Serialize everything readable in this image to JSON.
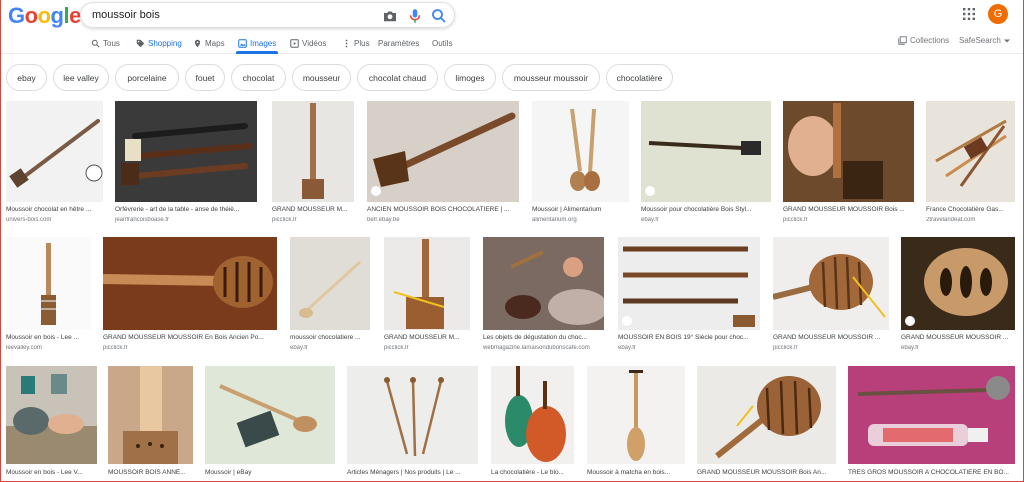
{
  "header": {
    "query": "moussoir bois",
    "avatar_letter": "G"
  },
  "tabs": [
    {
      "label": "Tous",
      "icon": "search-icon"
    },
    {
      "label": "Shopping",
      "icon": "tag-icon"
    },
    {
      "label": "Maps",
      "icon": "pin-icon"
    },
    {
      "label": "Images",
      "icon": "image-icon"
    },
    {
      "label": "Vidéos",
      "icon": "video-icon"
    },
    {
      "label": "Plus",
      "icon": "more-vert-icon"
    },
    {
      "label": "Paramètres",
      "icon": ""
    },
    {
      "label": "Outils",
      "icon": ""
    }
  ],
  "tools": {
    "collections": "Collections",
    "safesearch": "SafeSearch"
  },
  "chips": [
    "ebay",
    "lee valley",
    "porcelaine",
    "fouet",
    "chocolat",
    "mousseur",
    "chocolat chaud",
    "limoges",
    "mousseur moussoir",
    "chocolatière"
  ],
  "results": [
    {
      "caption": "Moussoir chocolat en hêtre ...",
      "source": "univers-bois.com"
    },
    {
      "caption": "Orfèvrerie - art de la table - anse de théiè...",
      "source": "jeanfrancoisboase.fr"
    },
    {
      "caption": "GRAND MOUSSEUR M...",
      "source": "picclick.fr"
    },
    {
      "caption": "ANCIEN MOUSSOIR BOIS CHOCOLATIERE | ...",
      "source": "befr.ebay.be"
    },
    {
      "caption": "Moussoir | Alimentarium",
      "source": "alimentarium.org"
    },
    {
      "caption": "Moussoir pour chocolatière Bois Styl...",
      "source": "ebay.fr"
    },
    {
      "caption": "GRAND MOUSSEUR MOUSSOIR Bois ...",
      "source": "picclick.fr"
    },
    {
      "caption": "France Chocolatière Gas...",
      "source": "2travelandeat.com"
    },
    {
      "caption": "Moussoir en bois - Lee ...",
      "source": "leevalley.com"
    },
    {
      "caption": "GRAND MOUSSEUR MOUSSOIR En Bois Ancien Po...",
      "source": "picclick.fr"
    },
    {
      "caption": "moussoir chocolatiere ...",
      "source": "ebay.fr"
    },
    {
      "caption": "GRAND MOUSSEUR M...",
      "source": "picclick.fr"
    },
    {
      "caption": "Les objets de dégustation du choc...",
      "source": "webmagazine.lamaisondubonscafe.com"
    },
    {
      "caption": "MOUSSOIR EN BOIS 19° Siècle pour choc...",
      "source": "ebay.fr"
    },
    {
      "caption": "GRAND MOUSSEUR MOUSSOIR ...",
      "source": "picclick.fr"
    },
    {
      "caption": "GRAND MOUSSEUR MOUSSOIR ...",
      "source": "ebay.fr"
    },
    {
      "caption": "Moussoir en bois - Lee V...",
      "source": ""
    },
    {
      "caption": "MOUSSOIR BOIS ANNÉ...",
      "source": ""
    },
    {
      "caption": "Moussoir | eBay",
      "source": ""
    },
    {
      "caption": "Articles Ménagers | Nos produits | Le ...",
      "source": ""
    },
    {
      "caption": "La chocolatière - Le blo...",
      "source": ""
    },
    {
      "caption": "Moussoir à matcha en bois...",
      "source": ""
    },
    {
      "caption": "GRAND MOUSSEUR MOUSSOIR Bois An...",
      "source": ""
    },
    {
      "caption": "TRES GROS MOUSSOIR A CHOCOLATIERE EN BO...",
      "source": ""
    }
  ]
}
